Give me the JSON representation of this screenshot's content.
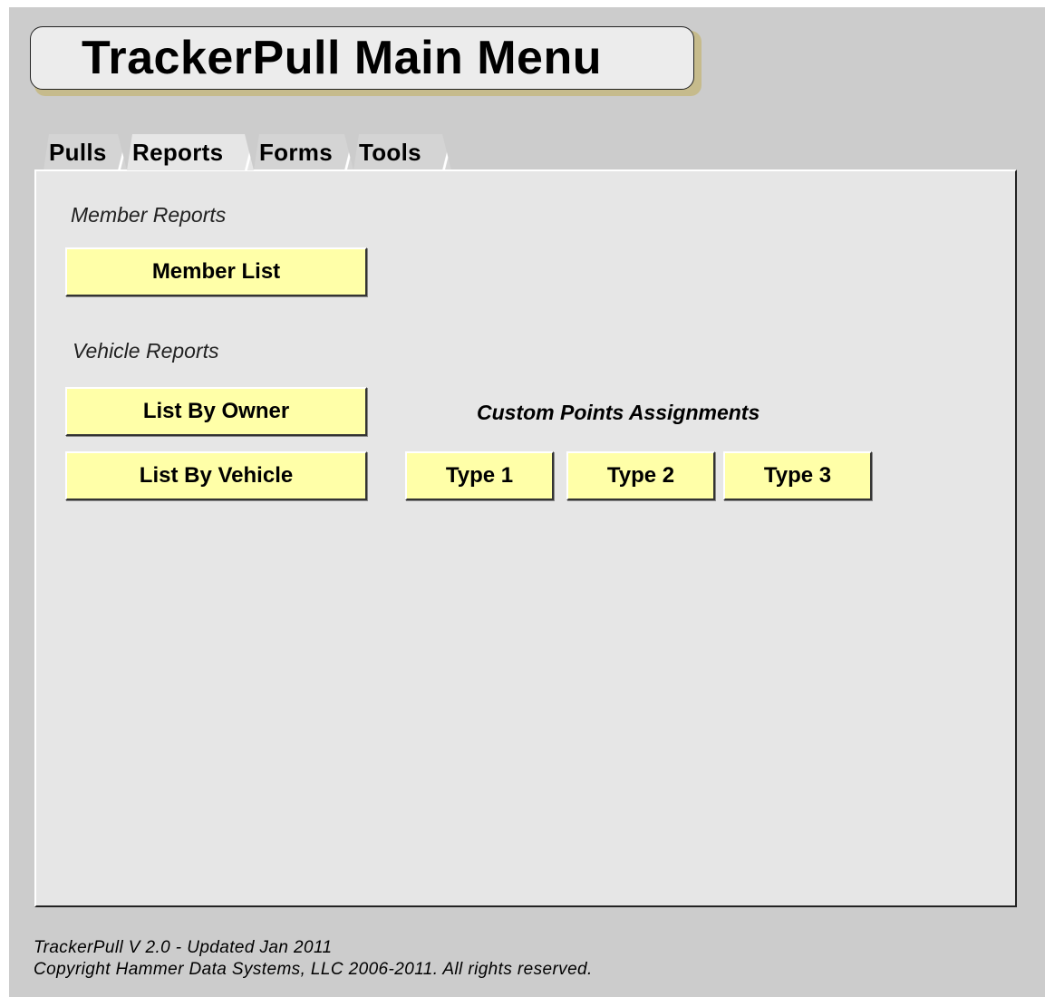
{
  "header": {
    "title": "TrackerPull Main Menu"
  },
  "tabs": [
    {
      "label": "Pulls",
      "active": false
    },
    {
      "label": "Reports",
      "active": true
    },
    {
      "label": "Forms",
      "active": false
    },
    {
      "label": "Tools",
      "active": false
    }
  ],
  "reports": {
    "member_section_label": "Member Reports",
    "member_list_label": "Member List",
    "vehicle_section_label": "Vehicle Reports",
    "list_by_owner_label": "List By Owner",
    "list_by_vehicle_label": "List By Vehicle",
    "custom_points_label": "Custom Points Assignments",
    "type_buttons": [
      "Type 1",
      "Type 2",
      "Type 3"
    ]
  },
  "footer": {
    "version": "TrackerPull V 2.0 - Updated Jan 2011",
    "copyright": "Copyright Hammer Data Systems, LLC 2006-2011. All rights reserved."
  },
  "colors": {
    "background": "#cccccc",
    "panel": "#e6e6e6",
    "button": "#ffffa8",
    "title_shadow": "#c6bb8c"
  }
}
